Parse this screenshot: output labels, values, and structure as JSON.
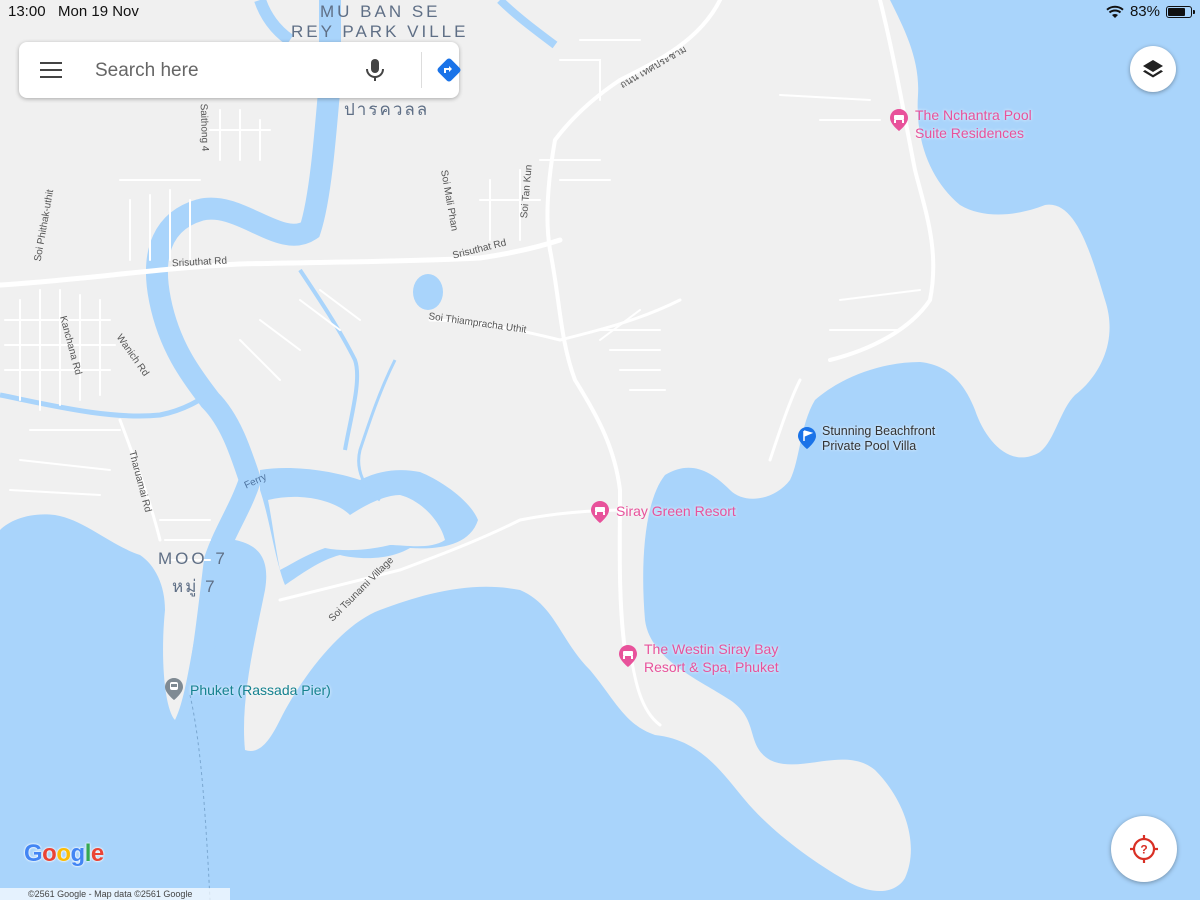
{
  "status_bar": {
    "time": "13:00",
    "date": "Mon 19 Nov",
    "battery": "83%",
    "battery_level": 0.83
  },
  "search": {
    "placeholder": "Search here"
  },
  "map_labels": {
    "area_mu_ban_1": "MU BAN SE",
    "area_mu_ban_2": "REY PARK VILLE",
    "area_thai_park": "ปารควลล",
    "area_moo7": "MOO 7",
    "area_moo7_thai": "หมู่ 7",
    "road_srisuthat_1": "Srisuthat Rd",
    "road_srisuthat_2": "Srisuthat Rd",
    "road_thiamp": "Soi Thiamprachа Uthit",
    "road_wanich": "Wanich Rd",
    "road_kanchana": "Kanchana Rd",
    "road_tharuamai": "Tharuamai Rd",
    "road_phithak": "Soi Phithak-uthit",
    "road_sathong": "Saithong 4",
    "road_mali": "Soi Mali Phan",
    "road_tankun": "Soi Tan Kun",
    "road_thai": "ถนน เทศประชาม",
    "road_tsunami": "Soi Tsunami Village",
    "ferry": "Ferry"
  },
  "places": [
    {
      "name_line1": "The Nchantra Pool",
      "name_line2": "Suite Residences",
      "type": "hotel",
      "color": "#e8529b"
    },
    {
      "name_line1": "Stunning Beachfront",
      "name_line2": "Private Pool Villa",
      "type": "flag",
      "color": "#1a73e8"
    },
    {
      "name_line1": "Siray Green Resort",
      "name_line2": "",
      "type": "hotel",
      "color": "#e8529b"
    },
    {
      "name_line1": "The Westin Siray Bay",
      "name_line2": "Resort & Spa, Phuket",
      "type": "hotel",
      "color": "#e8529b"
    },
    {
      "name_line1": "Phuket (Rassada Pier)",
      "name_line2": "",
      "type": "transit",
      "color": "#15828f"
    }
  ],
  "google_logo": "Google",
  "copyright": "©2561 Google - Map data ©2561 Google",
  "colors": {
    "water": "#a9d4fb",
    "land": "#f0f0f0",
    "road": "#ffffff",
    "hotel": "#e8529b",
    "transit": "#15828f",
    "accent": "#1a73e8"
  }
}
